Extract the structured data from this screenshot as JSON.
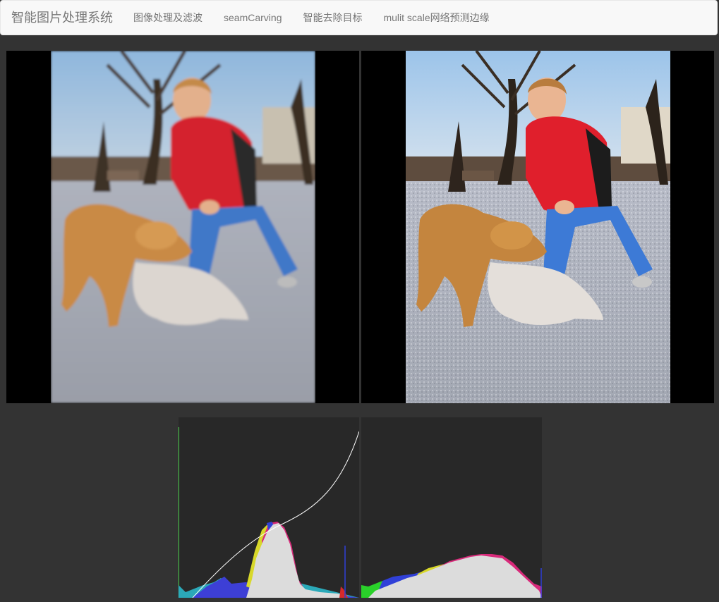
{
  "navbar": {
    "brand": "智能图片处理系统",
    "links": [
      "图像处理及滤波",
      "seamCarving",
      "智能去除目标",
      "mulit scale网络预测边缘"
    ]
  },
  "colors": {
    "page_bg": "#333333",
    "navbar_bg": "#f8f8f8",
    "nav_text": "#777777",
    "panel_bg": "#000000",
    "hist_bg": "#282828"
  },
  "images": {
    "left": {
      "description_icon": "photo-icon",
      "variant": "blurred"
    },
    "right": {
      "description_icon": "photo-icon",
      "variant": "sharpened"
    }
  },
  "histograms": {
    "left": {
      "has_curve": true,
      "peak_level": 0.68,
      "icon": "histogram-icon"
    },
    "right": {
      "has_curve": false,
      "peak_level": 0.24,
      "icon": "histogram-icon"
    }
  }
}
